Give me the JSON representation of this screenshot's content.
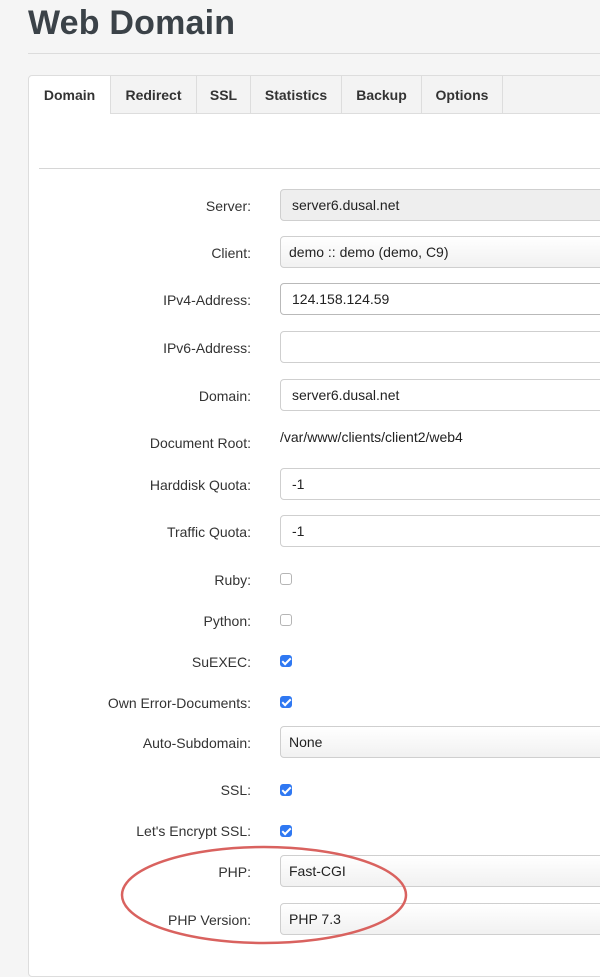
{
  "page": {
    "title": "Web Domain"
  },
  "tabs": [
    "Domain",
    "Redirect",
    "SSL",
    "Statistics",
    "Backup",
    "Options"
  ],
  "form": {
    "server": {
      "label": "Server:",
      "value": "server6.dusal.net"
    },
    "client": {
      "label": "Client:",
      "value": "demo :: demo (demo, C9)"
    },
    "ipv4": {
      "label": "IPv4-Address:",
      "value": "124.158.124.59"
    },
    "ipv6": {
      "label": "IPv6-Address:",
      "value": ""
    },
    "domain": {
      "label": "Domain:",
      "value": "server6.dusal.net"
    },
    "document_root": {
      "label": "Document Root:",
      "value": "/var/www/clients/client2/web4"
    },
    "harddisk_quota": {
      "label": "Harddisk Quota:",
      "value": "-1"
    },
    "traffic_quota": {
      "label": "Traffic Quota:",
      "value": "-1"
    },
    "ruby": {
      "label": "Ruby:",
      "checked": false
    },
    "python": {
      "label": "Python:",
      "checked": false
    },
    "suexec": {
      "label": "SuEXEC:",
      "checked": true
    },
    "own_error_documents": {
      "label": "Own Error-Documents:",
      "checked": true
    },
    "auto_subdomain": {
      "label": "Auto-Subdomain:",
      "value": "None"
    },
    "ssl": {
      "label": "SSL:",
      "checked": true
    },
    "lets_encrypt_ssl": {
      "label": "Let's Encrypt SSL:",
      "checked": true
    },
    "php": {
      "label": "PHP:",
      "value": "Fast-CGI"
    },
    "php_version": {
      "label": "PHP Version:",
      "value": "PHP 7.3"
    }
  },
  "colors": {
    "checkbox_checked": "#2f78f2",
    "annotation_circle": "#d9625f"
  }
}
